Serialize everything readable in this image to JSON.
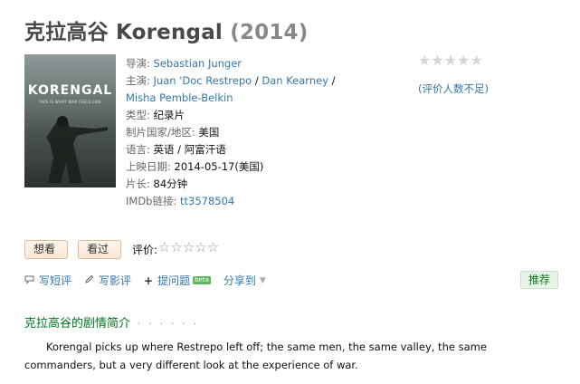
{
  "title": {
    "main": "克拉高谷 Korengal",
    "year": "(2014)"
  },
  "poster": {
    "title": "KORENGAL",
    "subtitle": "THIS IS WHAT WAR FEELS LIKE"
  },
  "info": {
    "director_label": "导演:",
    "director": "Sebastian Junger",
    "cast_label": "主演:",
    "cast": [
      "Juan 'Doc Restrepo",
      "Dan Kearney",
      "Misha Pemble-Belkin"
    ],
    "cast_separator": " / ",
    "genre_label": "类型:",
    "genre": "纪录片",
    "country_label": "制片国家/地区:",
    "country": "美国",
    "language_label": "语言:",
    "language": "英语 / 阿富汗语",
    "release_label": "上映日期:",
    "release": "2014-05-17(美国)",
    "runtime_label": "片长:",
    "runtime": "84分钟",
    "imdb_label": "IMDb链接:",
    "imdb": "tt3578504"
  },
  "rating": {
    "stars": "★★★★★",
    "note": "(评价人数不足)"
  },
  "buttons": {
    "want": "想看",
    "seen": "看过",
    "rate_label": "评价:",
    "rate_stars": "☆☆☆☆☆"
  },
  "actions": {
    "short_review": "写短评",
    "review": "写影评",
    "question": "提问题",
    "beta": "beta",
    "share": "分享到",
    "recommend": "推荐"
  },
  "synopsis": {
    "title": "克拉高谷的剧情简介",
    "dots": "· · · · · ·",
    "text": "Korengal picks up where Restrepo left off; the same men, the same valley, the same commanders, but a very different look at the experience of war."
  },
  "colors": {
    "link": "#3377aa",
    "green": "#007722",
    "title": "#494949",
    "year": "#888888"
  }
}
